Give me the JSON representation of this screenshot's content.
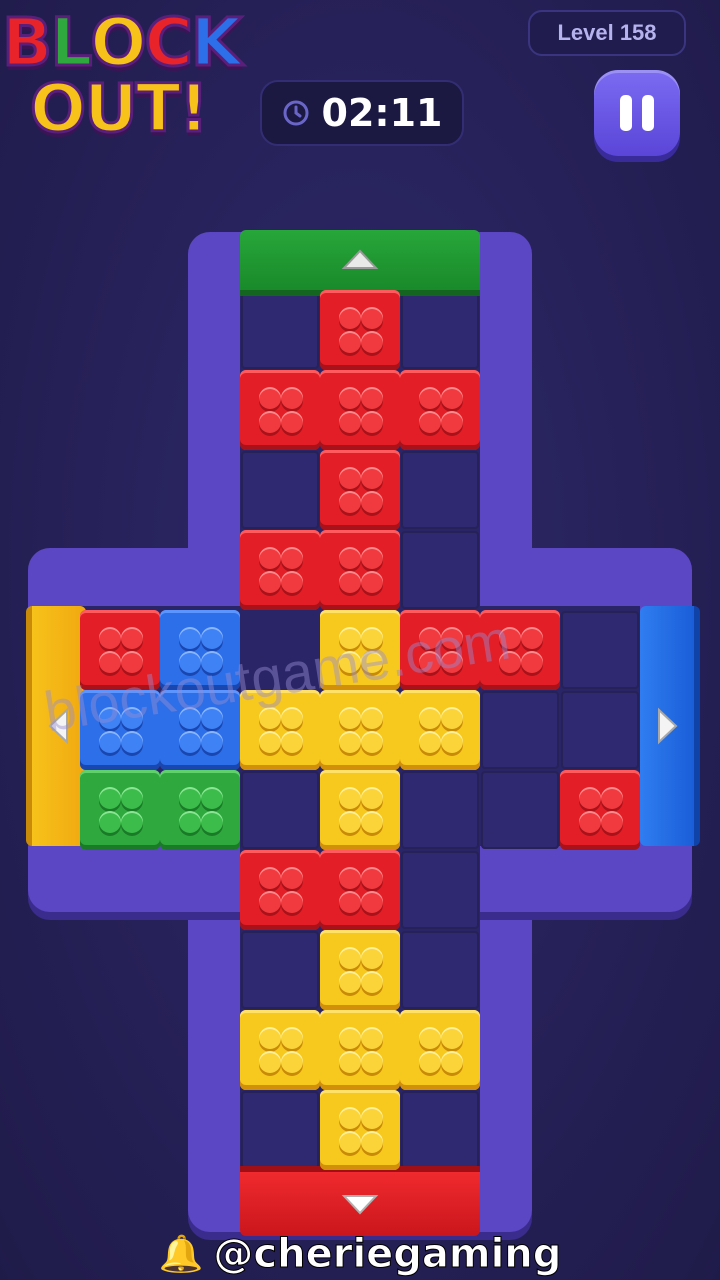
{
  "header": {
    "logo_line1": [
      "B",
      "L",
      "O",
      "C",
      "K"
    ],
    "logo_line2": [
      "O",
      "U",
      "T",
      "!"
    ],
    "logo_colors1": [
      "#e8232a",
      "#2fa83e",
      "#f7c21a",
      "#e8232a",
      "#2d6fe8"
    ],
    "logo_colors2": [
      "#f7c21a",
      "#f7c21a",
      "#f7c21a",
      "#f7c21a"
    ],
    "level_label": "Level 158",
    "timer": "02:11"
  },
  "board": {
    "gates": {
      "top": "green",
      "bottom": "red",
      "left": "yellow",
      "right": "blue"
    },
    "pieces": [
      {
        "color": "red",
        "shape": "plus-cross"
      },
      {
        "color": "red",
        "shape": "single"
      },
      {
        "color": "red",
        "shape": "single"
      },
      {
        "color": "blue",
        "shape": "L"
      },
      {
        "color": "green",
        "shape": "domino"
      },
      {
        "color": "yellow",
        "shape": "plus-cross"
      },
      {
        "color": "red",
        "shape": "domino"
      },
      {
        "color": "red",
        "shape": "single"
      },
      {
        "color": "red",
        "shape": "domino"
      },
      {
        "color": "yellow",
        "shape": "plus-cross"
      }
    ]
  },
  "watermark": "blockoutgame.com",
  "footer": {
    "handle": "@cheriegaming"
  }
}
